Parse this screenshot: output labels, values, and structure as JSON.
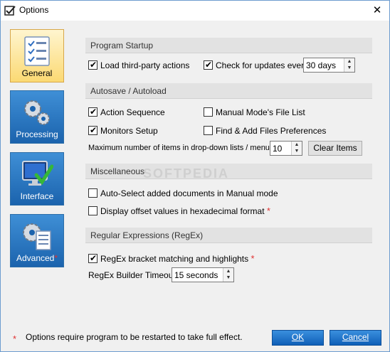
{
  "window": {
    "title": "Options",
    "close_glyph": "✕"
  },
  "nav": {
    "items": [
      {
        "label": "General",
        "icon": "general-checklist-icon",
        "active": true
      },
      {
        "label": "Processing",
        "icon": "gears-icon",
        "active": false
      },
      {
        "label": "Interface",
        "icon": "monitor-check-icon",
        "active": false
      },
      {
        "label": "Advanced",
        "icon": "gear-document-icon",
        "active": false,
        "star": "*"
      }
    ]
  },
  "sections": {
    "startup": {
      "title": "Program Startup",
      "load_third_party": {
        "label": "Load third-party actions",
        "checked": true
      },
      "check_updates": {
        "label": "Check for updates every",
        "checked": true
      },
      "update_interval": "30 days"
    },
    "autosave": {
      "title": "Autosave / Autoload",
      "action_sequence": {
        "label": "Action Sequence",
        "checked": true
      },
      "manual_mode_file_list": {
        "label": "Manual Mode's File List",
        "checked": false
      },
      "monitors_setup": {
        "label": "Monitors Setup",
        "checked": true
      },
      "find_add_files": {
        "label": "Find & Add Files Preferences",
        "checked": false
      },
      "max_items_label": "Maximum number of items in drop-down lists / menus:",
      "max_items_value": "10",
      "clear_items_label": "Clear Items"
    },
    "misc": {
      "title": "Miscellaneous",
      "auto_select": {
        "label": "Auto-Select added documents in Manual mode",
        "checked": false
      },
      "display_offset": {
        "label": "Display offset values in hexadecimal format",
        "checked": false,
        "star": "*"
      }
    },
    "regex": {
      "title": "Regular Expressions (RegEx)",
      "bracket_matching": {
        "label": "RegEx bracket matching and highlights",
        "checked": true,
        "star": "*"
      },
      "timeout_label": "RegEx Builder Timeout:",
      "timeout_value": "15 seconds"
    }
  },
  "footer": {
    "star": "*",
    "note": "Options require program to be restarted to take full effect.",
    "ok_label": "OK",
    "cancel_label": "Cancel"
  },
  "watermark": "SOFTPEDIA",
  "colors": {
    "accent": "#1b63ad",
    "active_nav": "#fbd973",
    "required_star": "#e03131",
    "section_header": "#e2e2e2"
  }
}
